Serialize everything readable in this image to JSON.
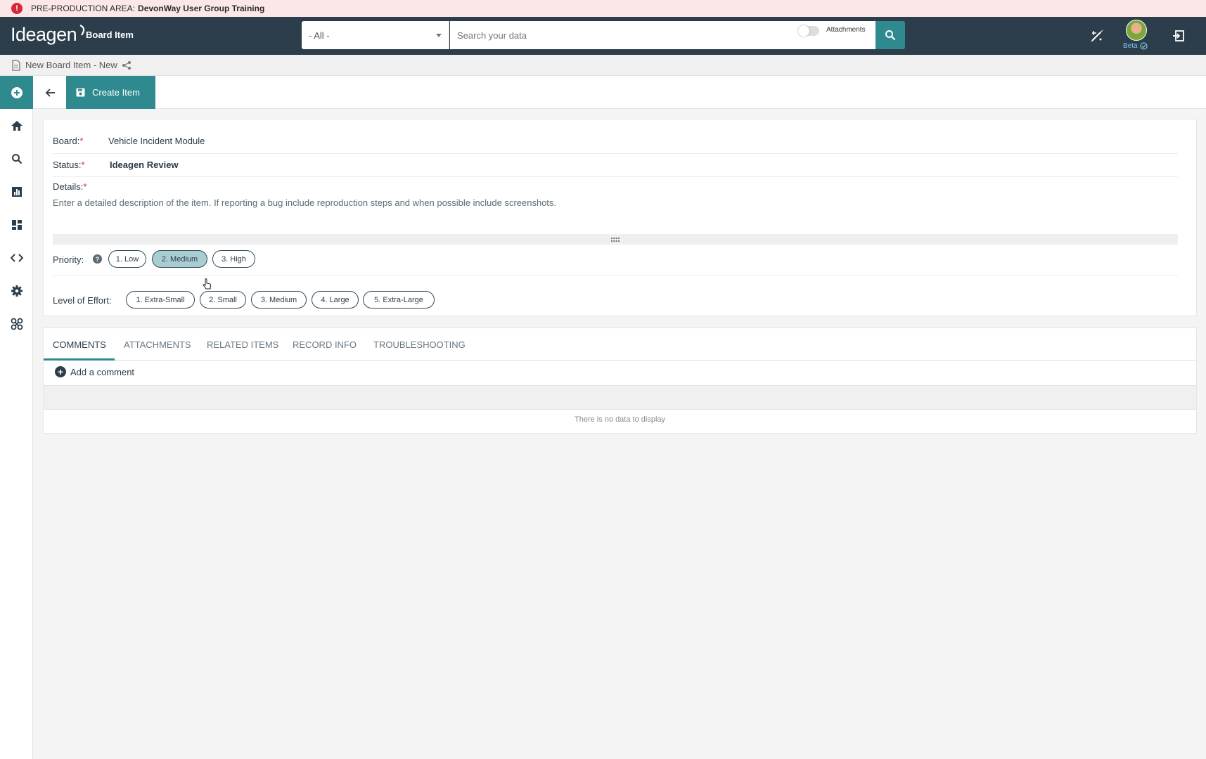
{
  "banner": {
    "prefix": "PRE-PRODUCTION AREA:",
    "env_name": "DevonWay User Group Training",
    "alert_glyph": "!"
  },
  "header": {
    "logo_text": "Ideagen",
    "app_title": "Board Item",
    "scope_value": "- All -",
    "search_placeholder": "Search your data",
    "attachments_toggle_label": "Attachments",
    "beta_label": "Beta",
    "accent_color": "#2e8a8f",
    "bar_color": "#2c3e4b"
  },
  "breadcrumb": {
    "title": "New Board Item - New"
  },
  "sidebar": {
    "icons": [
      "plus-circle-icon",
      "home-icon",
      "search-icon",
      "bar-chart-icon",
      "dashboard-icon",
      "code-icon",
      "gear-icon",
      "integrations-icon"
    ]
  },
  "toolbar": {
    "create_label": "Create Item"
  },
  "form": {
    "board_label": "Board:",
    "board_value": "Vehicle Incident Module",
    "status_label": "Status:",
    "status_value": "Ideagen Review",
    "details_label": "Details:",
    "details_placeholder": "Enter a detailed description of the item. If reporting a bug include reproduction steps and when possible include screenshots.",
    "required_mark": "*",
    "priority_label": "Priority:",
    "priority_help_glyph": "?",
    "priority_options": [
      "1. Low",
      "2. Medium",
      "3. High"
    ],
    "priority_selected": "2. Medium",
    "effort_label": "Level of Effort:",
    "effort_options": [
      "1. Extra-Small",
      "2. Small",
      "3. Medium",
      "4. Large",
      "5. Extra-Large"
    ]
  },
  "tabs": {
    "items": [
      "COMMENTS",
      "ATTACHMENTS",
      "RELATED ITEMS",
      "RECORD INFO",
      "TROUBLESHOOTING"
    ],
    "active": "COMMENTS",
    "add_comment_label": "Add a comment",
    "empty_text": "There is no data to display"
  }
}
